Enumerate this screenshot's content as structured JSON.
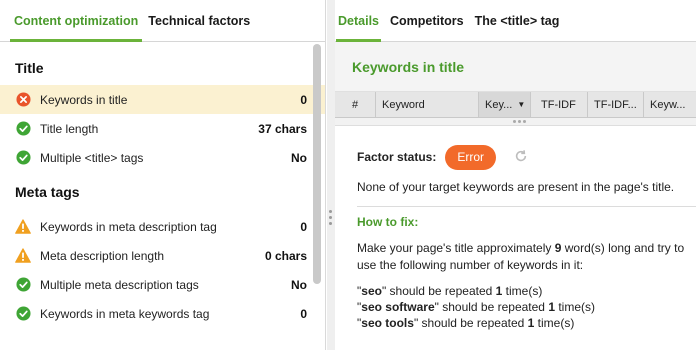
{
  "left_tabs": [
    "Content optimization",
    "Technical factors"
  ],
  "sections": [
    {
      "title": "Title",
      "rows": [
        {
          "label": "Keywords in title",
          "value": "0",
          "status": "error"
        },
        {
          "label": "Title length",
          "value": "37 chars",
          "status": "ok"
        },
        {
          "label": "Multiple <title> tags",
          "value": "No",
          "status": "ok"
        }
      ]
    },
    {
      "title": "Meta tags",
      "rows": [
        {
          "label": "Keywords in meta description tag",
          "value": "0",
          "status": "warning"
        },
        {
          "label": "Meta description length",
          "value": "0 chars",
          "status": "warning"
        },
        {
          "label": "Multiple meta description tags",
          "value": "No",
          "status": "ok"
        },
        {
          "label": "Keywords in meta keywords tag",
          "value": "0",
          "status": "ok"
        }
      ]
    }
  ],
  "right_tabs": [
    "Details",
    "Competitors",
    "The <title> tag"
  ],
  "panel_title": "Keywords in title",
  "grid_columns": [
    "#",
    "Keyword",
    "Key...",
    "TF-IDF",
    "TF-IDF...",
    "Keyw..."
  ],
  "details": {
    "status_label": "Factor status:",
    "status_badge": "Error",
    "message": "None of your target keywords are present in the page's title.",
    "how_to_fix_label": "How to fix:",
    "fix_text_before": "Make your page's title approximately ",
    "fix_number": "9",
    "fix_text_after": " word(s) long and try to use the following number of keywords in it:",
    "repetitions": [
      {
        "keyword": "seo",
        "count": "1"
      },
      {
        "keyword": "seo software",
        "count": "1"
      },
      {
        "keyword": "seo tools",
        "count": "1"
      }
    ],
    "rep_prefix": " should be repeated ",
    "rep_suffix": " time(s)"
  },
  "colors": {
    "accent": "#4a9a2c",
    "error": "#f26a2a",
    "warning": "#f0a020",
    "ok": "#3fa535"
  }
}
